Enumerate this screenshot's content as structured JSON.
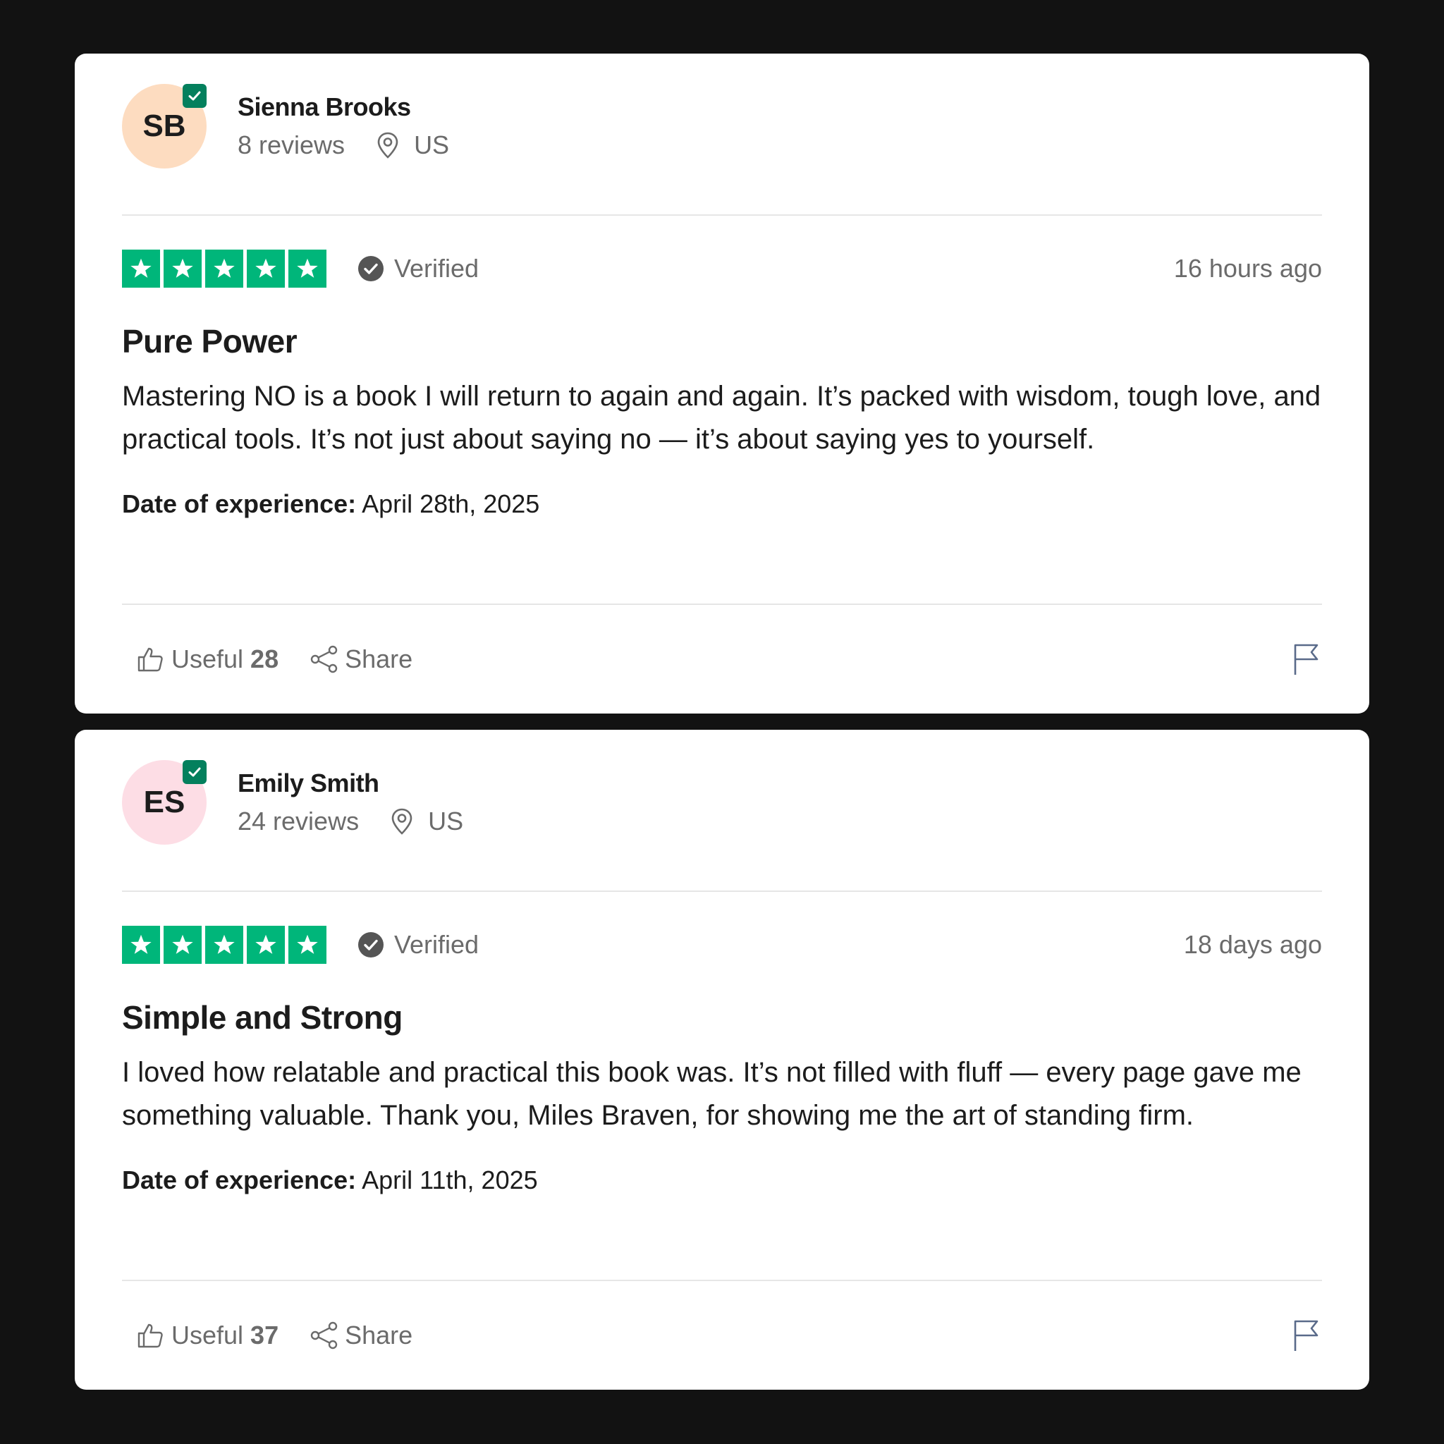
{
  "reviews": [
    {
      "initials": "SB",
      "avatar_color": "#fddcc0",
      "name": "Sienna Brooks",
      "reviews_count": "8 reviews",
      "location": "US",
      "rating": 5,
      "verified_label": "Verified",
      "time_ago": "16 hours ago",
      "title": "Pure Power",
      "body": "Mastering NO is a book I will return to again and again. It’s packed with wisdom, tough love, and practical tools. It’s not just about saying no — it’s about saying yes to yourself.",
      "date_label": "Date of experience:",
      "date_value": "April 28th, 2025",
      "useful_label": "Useful",
      "useful_count": "28",
      "share_label": "Share"
    },
    {
      "initials": "ES",
      "avatar_color": "#fddde5",
      "name": "Emily Smith",
      "reviews_count": "24 reviews",
      "location": "US",
      "rating": 5,
      "verified_label": "Verified",
      "time_ago": "18 days ago",
      "title": "Simple and Strong",
      "body": "I loved how relatable and practical this book was. It’s not filled with fluff — every page gave me something valuable. Thank you, Miles Braven, for showing me the art of standing firm.",
      "date_label": "Date of experience:",
      "date_value": "April 11th, 2025",
      "useful_label": "Useful",
      "useful_count": "37",
      "share_label": "Share"
    }
  ],
  "colors": {
    "star_green": "#00b67a",
    "badge_green": "#04805d",
    "background": "#121212"
  },
  "icons": {
    "verified_badge": "check-badge-icon",
    "location": "map-pin-icon",
    "verified": "check-circle-icon",
    "star": "star-icon",
    "useful": "thumbs-up-icon",
    "share": "share-icon",
    "flag": "flag-icon"
  }
}
